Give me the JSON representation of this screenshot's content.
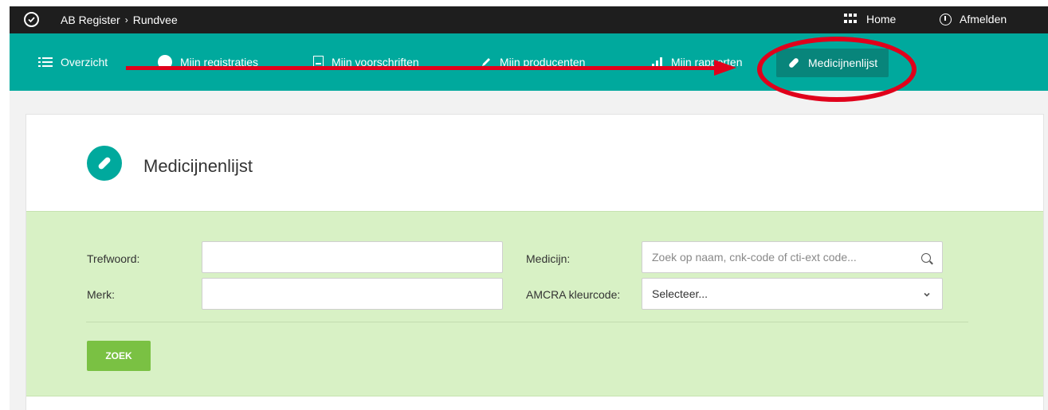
{
  "topbar": {
    "breadcrumb_app": "AB Register",
    "breadcrumb_sep": "›",
    "breadcrumb_section": "Rundvee",
    "home_label": "Home",
    "logout_label": "Afmelden"
  },
  "nav": {
    "items": [
      {
        "label": "Overzicht",
        "icon": "list-icon"
      },
      {
        "label": "Mijn registraties",
        "icon": "check-circle-icon"
      },
      {
        "label": "Mijn voorschriften",
        "icon": "document-icon"
      },
      {
        "label": "Mijn producenten",
        "icon": "pen-icon"
      },
      {
        "label": "Mijn rapporten",
        "icon": "bar-chart-icon"
      },
      {
        "label": "Medicijnenlijst",
        "icon": "pill-icon",
        "active": true
      }
    ]
  },
  "page": {
    "title": "Medicijnenlijst"
  },
  "filter": {
    "trefwoord_label": "Trefwoord:",
    "trefwoord_value": "",
    "merk_label": "Merk:",
    "merk_value": "",
    "medicijn_label": "Medicijn:",
    "medicijn_placeholder": "Zoek op naam, cnk-code of cti-ext code...",
    "amcra_label": "AMCRA kleurcode:",
    "amcra_selected": "Selecteer...",
    "search_button": "ZOEK"
  },
  "colors": {
    "topbar": "#1e1e1e",
    "nav": "#00a99d",
    "nav_active": "#08857b",
    "filter_bg": "#d8f1c5",
    "button": "#7ac143",
    "annotation": "#e0001b"
  }
}
